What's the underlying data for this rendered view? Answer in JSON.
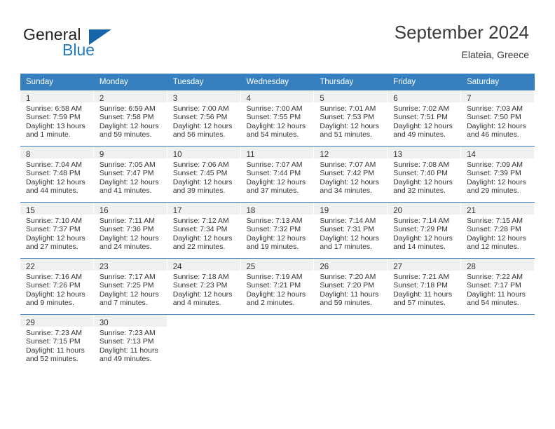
{
  "brand": {
    "name_top": "General",
    "name_bottom": "Blue",
    "triangle_icon": "blue-triangle-icon",
    "accent_color": "#1f7ac0",
    "header_color": "#3680c0"
  },
  "header": {
    "title": "September 2024",
    "subtitle": "Elateia, Greece"
  },
  "weekday_headers": [
    "Sunday",
    "Monday",
    "Tuesday",
    "Wednesday",
    "Thursday",
    "Friday",
    "Saturday"
  ],
  "weeks": [
    [
      {
        "day": "1",
        "sunrise": "Sunrise: 6:58 AM",
        "sunset": "Sunset: 7:59 PM",
        "daylight_1": "Daylight: 13 hours",
        "daylight_2": "and 1 minute."
      },
      {
        "day": "2",
        "sunrise": "Sunrise: 6:59 AM",
        "sunset": "Sunset: 7:58 PM",
        "daylight_1": "Daylight: 12 hours",
        "daylight_2": "and 59 minutes."
      },
      {
        "day": "3",
        "sunrise": "Sunrise: 7:00 AM",
        "sunset": "Sunset: 7:56 PM",
        "daylight_1": "Daylight: 12 hours",
        "daylight_2": "and 56 minutes."
      },
      {
        "day": "4",
        "sunrise": "Sunrise: 7:00 AM",
        "sunset": "Sunset: 7:55 PM",
        "daylight_1": "Daylight: 12 hours",
        "daylight_2": "and 54 minutes."
      },
      {
        "day": "5",
        "sunrise": "Sunrise: 7:01 AM",
        "sunset": "Sunset: 7:53 PM",
        "daylight_1": "Daylight: 12 hours",
        "daylight_2": "and 51 minutes."
      },
      {
        "day": "6",
        "sunrise": "Sunrise: 7:02 AM",
        "sunset": "Sunset: 7:51 PM",
        "daylight_1": "Daylight: 12 hours",
        "daylight_2": "and 49 minutes."
      },
      {
        "day": "7",
        "sunrise": "Sunrise: 7:03 AM",
        "sunset": "Sunset: 7:50 PM",
        "daylight_1": "Daylight: 12 hours",
        "daylight_2": "and 46 minutes."
      }
    ],
    [
      {
        "day": "8",
        "sunrise": "Sunrise: 7:04 AM",
        "sunset": "Sunset: 7:48 PM",
        "daylight_1": "Daylight: 12 hours",
        "daylight_2": "and 44 minutes."
      },
      {
        "day": "9",
        "sunrise": "Sunrise: 7:05 AM",
        "sunset": "Sunset: 7:47 PM",
        "daylight_1": "Daylight: 12 hours",
        "daylight_2": "and 41 minutes."
      },
      {
        "day": "10",
        "sunrise": "Sunrise: 7:06 AM",
        "sunset": "Sunset: 7:45 PM",
        "daylight_1": "Daylight: 12 hours",
        "daylight_2": "and 39 minutes."
      },
      {
        "day": "11",
        "sunrise": "Sunrise: 7:07 AM",
        "sunset": "Sunset: 7:44 PM",
        "daylight_1": "Daylight: 12 hours",
        "daylight_2": "and 37 minutes."
      },
      {
        "day": "12",
        "sunrise": "Sunrise: 7:07 AM",
        "sunset": "Sunset: 7:42 PM",
        "daylight_1": "Daylight: 12 hours",
        "daylight_2": "and 34 minutes."
      },
      {
        "day": "13",
        "sunrise": "Sunrise: 7:08 AM",
        "sunset": "Sunset: 7:40 PM",
        "daylight_1": "Daylight: 12 hours",
        "daylight_2": "and 32 minutes."
      },
      {
        "day": "14",
        "sunrise": "Sunrise: 7:09 AM",
        "sunset": "Sunset: 7:39 PM",
        "daylight_1": "Daylight: 12 hours",
        "daylight_2": "and 29 minutes."
      }
    ],
    [
      {
        "day": "15",
        "sunrise": "Sunrise: 7:10 AM",
        "sunset": "Sunset: 7:37 PM",
        "daylight_1": "Daylight: 12 hours",
        "daylight_2": "and 27 minutes."
      },
      {
        "day": "16",
        "sunrise": "Sunrise: 7:11 AM",
        "sunset": "Sunset: 7:36 PM",
        "daylight_1": "Daylight: 12 hours",
        "daylight_2": "and 24 minutes."
      },
      {
        "day": "17",
        "sunrise": "Sunrise: 7:12 AM",
        "sunset": "Sunset: 7:34 PM",
        "daylight_1": "Daylight: 12 hours",
        "daylight_2": "and 22 minutes."
      },
      {
        "day": "18",
        "sunrise": "Sunrise: 7:13 AM",
        "sunset": "Sunset: 7:32 PM",
        "daylight_1": "Daylight: 12 hours",
        "daylight_2": "and 19 minutes."
      },
      {
        "day": "19",
        "sunrise": "Sunrise: 7:14 AM",
        "sunset": "Sunset: 7:31 PM",
        "daylight_1": "Daylight: 12 hours",
        "daylight_2": "and 17 minutes."
      },
      {
        "day": "20",
        "sunrise": "Sunrise: 7:14 AM",
        "sunset": "Sunset: 7:29 PM",
        "daylight_1": "Daylight: 12 hours",
        "daylight_2": "and 14 minutes."
      },
      {
        "day": "21",
        "sunrise": "Sunrise: 7:15 AM",
        "sunset": "Sunset: 7:28 PM",
        "daylight_1": "Daylight: 12 hours",
        "daylight_2": "and 12 minutes."
      }
    ],
    [
      {
        "day": "22",
        "sunrise": "Sunrise: 7:16 AM",
        "sunset": "Sunset: 7:26 PM",
        "daylight_1": "Daylight: 12 hours",
        "daylight_2": "and 9 minutes."
      },
      {
        "day": "23",
        "sunrise": "Sunrise: 7:17 AM",
        "sunset": "Sunset: 7:25 PM",
        "daylight_1": "Daylight: 12 hours",
        "daylight_2": "and 7 minutes."
      },
      {
        "day": "24",
        "sunrise": "Sunrise: 7:18 AM",
        "sunset": "Sunset: 7:23 PM",
        "daylight_1": "Daylight: 12 hours",
        "daylight_2": "and 4 minutes."
      },
      {
        "day": "25",
        "sunrise": "Sunrise: 7:19 AM",
        "sunset": "Sunset: 7:21 PM",
        "daylight_1": "Daylight: 12 hours",
        "daylight_2": "and 2 minutes."
      },
      {
        "day": "26",
        "sunrise": "Sunrise: 7:20 AM",
        "sunset": "Sunset: 7:20 PM",
        "daylight_1": "Daylight: 11 hours",
        "daylight_2": "and 59 minutes."
      },
      {
        "day": "27",
        "sunrise": "Sunrise: 7:21 AM",
        "sunset": "Sunset: 7:18 PM",
        "daylight_1": "Daylight: 11 hours",
        "daylight_2": "and 57 minutes."
      },
      {
        "day": "28",
        "sunrise": "Sunrise: 7:22 AM",
        "sunset": "Sunset: 7:17 PM",
        "daylight_1": "Daylight: 11 hours",
        "daylight_2": "and 54 minutes."
      }
    ],
    [
      {
        "day": "29",
        "sunrise": "Sunrise: 7:23 AM",
        "sunset": "Sunset: 7:15 PM",
        "daylight_1": "Daylight: 11 hours",
        "daylight_2": "and 52 minutes."
      },
      {
        "day": "30",
        "sunrise": "Sunrise: 7:23 AM",
        "sunset": "Sunset: 7:13 PM",
        "daylight_1": "Daylight: 11 hours",
        "daylight_2": "and 49 minutes."
      },
      {
        "day": "",
        "sunrise": "",
        "sunset": "",
        "daylight_1": "",
        "daylight_2": ""
      },
      {
        "day": "",
        "sunrise": "",
        "sunset": "",
        "daylight_1": "",
        "daylight_2": ""
      },
      {
        "day": "",
        "sunrise": "",
        "sunset": "",
        "daylight_1": "",
        "daylight_2": ""
      },
      {
        "day": "",
        "sunrise": "",
        "sunset": "",
        "daylight_1": "",
        "daylight_2": ""
      },
      {
        "day": "",
        "sunrise": "",
        "sunset": "",
        "daylight_1": "",
        "daylight_2": ""
      }
    ]
  ]
}
